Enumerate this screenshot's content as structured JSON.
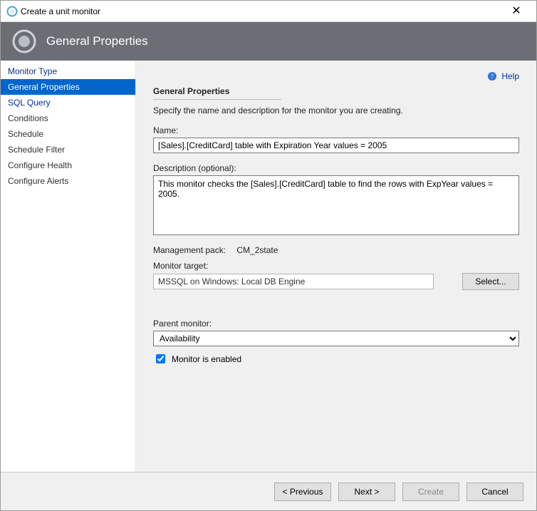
{
  "window": {
    "title": "Create a unit monitor",
    "close_glyph": "✕"
  },
  "banner": {
    "title": "General Properties"
  },
  "help": {
    "label": "Help"
  },
  "sidebar": {
    "items": [
      {
        "label": "Monitor Type",
        "selected": false
      },
      {
        "label": "General Properties",
        "selected": true
      },
      {
        "label": "SQL Query",
        "selected": false
      },
      {
        "label": "Conditions",
        "selected": false
      },
      {
        "label": "Schedule",
        "selected": false
      },
      {
        "label": "Schedule Filter",
        "selected": false
      },
      {
        "label": "Configure Health",
        "selected": false
      },
      {
        "label": "Configure Alerts",
        "selected": false
      }
    ]
  },
  "section": {
    "heading": "General Properties",
    "description": "Specify the name and description for the monitor you are creating.",
    "name_label": "Name:",
    "name_value": "[Sales].[CreditCard] table with Expiration Year values = 2005",
    "desc_label": "Description (optional):",
    "desc_value": "This monitor checks the [Sales].[CreditCard] table to find the rows with ExpYear values = 2005.",
    "mgmt_label": "Management pack:",
    "mgmt_value": "CM_2state",
    "target_label": "Monitor target:",
    "target_value": "MSSQL on Windows: Local DB Engine",
    "select_btn": "Select...",
    "parent_label": "Parent monitor:",
    "parent_value": "Availability",
    "enabled_label": "Monitor is enabled",
    "enabled_checked": true
  },
  "footer": {
    "previous": "< Previous",
    "next": "Next >",
    "create": "Create",
    "cancel": "Cancel"
  }
}
